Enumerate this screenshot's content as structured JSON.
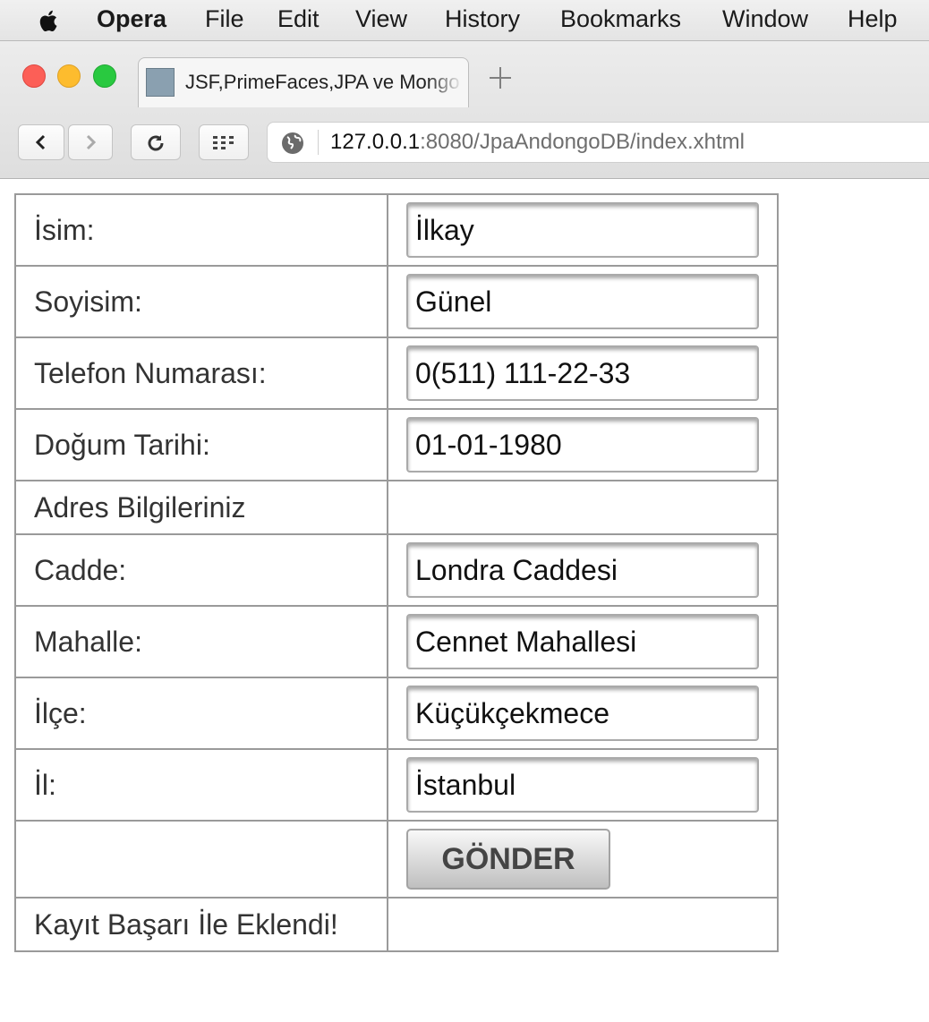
{
  "menubar": {
    "app_name": "Opera",
    "items": [
      "File",
      "Edit",
      "View",
      "History",
      "Bookmarks",
      "Window",
      "Help"
    ]
  },
  "browser": {
    "tab_title": "JSF,PrimeFaces,JPA ve MongoDB",
    "url_host": "127.0.0.1",
    "url_rest": ":8080/JpaAndongoDB/index.xhtml"
  },
  "form": {
    "name_label": "İsim:",
    "name_value": "İlkay",
    "surname_label": "Soyisim:",
    "surname_value": "Günel",
    "phone_label": "Telefon Numarası:",
    "phone_value": "0(511) 111-22-33",
    "birthdate_label": "Doğum Tarihi:",
    "birthdate_value": "01-01-1980",
    "address_header": "Adres Bilgileriniz",
    "street_label": "Cadde:",
    "street_value": "Londra Caddesi",
    "neighborhood_label": "Mahalle:",
    "neighborhood_value": "Cennet Mahallesi",
    "district_label": "İlçe:",
    "district_value": "Küçükçekmece",
    "city_label": "İl:",
    "city_value": "İstanbul",
    "submit_label": "GÖNDER",
    "status_message": "Kayıt Başarı İle Eklendi!"
  }
}
